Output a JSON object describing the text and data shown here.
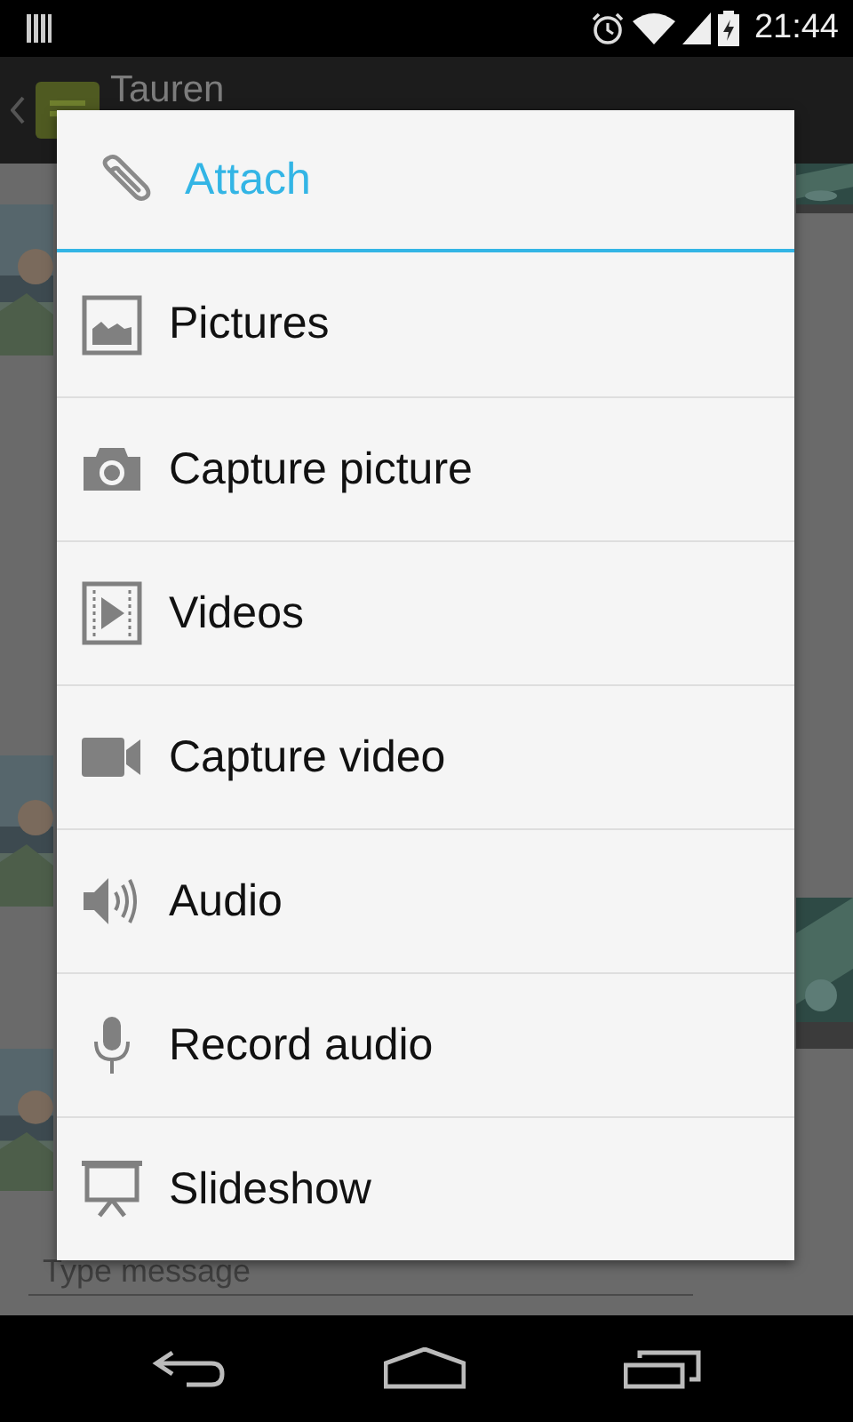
{
  "status_bar": {
    "time": "21:44"
  },
  "action_bar": {
    "title": "Tauren"
  },
  "composer": {
    "placeholder": "Type message"
  },
  "dialog": {
    "title": "Attach",
    "items": [
      {
        "label": "Pictures",
        "kind": "pictures"
      },
      {
        "label": "Capture picture",
        "kind": "camera"
      },
      {
        "label": "Videos",
        "kind": "videos"
      },
      {
        "label": "Capture video",
        "kind": "videocam"
      },
      {
        "label": "Audio",
        "kind": "audio"
      },
      {
        "label": "Record audio",
        "kind": "mic"
      },
      {
        "label": "Slideshow",
        "kind": "slideshow"
      }
    ]
  }
}
